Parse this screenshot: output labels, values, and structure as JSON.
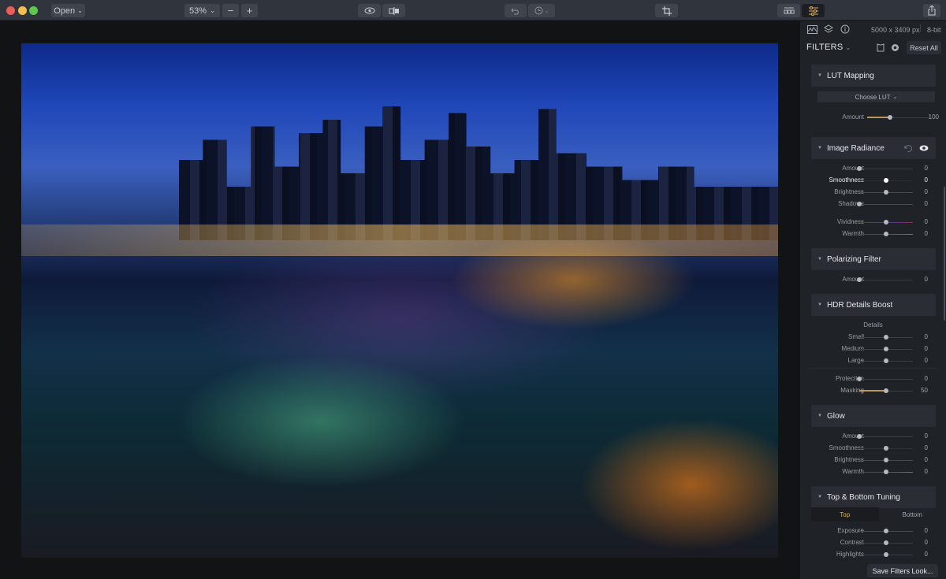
{
  "toolbar": {
    "open_label": "Open",
    "zoom_value": "53%",
    "zoom_out": "−",
    "zoom_in": "+",
    "traffic_colors": {
      "close": "#ed5f56",
      "minimize": "#f6be4f",
      "maximize": "#5dc84f"
    },
    "icons": {
      "eye": "eye-icon",
      "compare": "compare-icon",
      "undo": "undo-icon",
      "history": "history-icon",
      "crop": "crop-icon",
      "presets": "presets-icon",
      "filters": "sliders-icon",
      "share": "share-icon"
    },
    "accent": "#e0b054"
  },
  "sidebar": {
    "image_info": "5000 x 3409 px",
    "bit_depth": "8-bit",
    "filters_title": "FILTERS",
    "reset_all": "Reset All",
    "lut": {
      "title": "LUT Mapping",
      "choose": "Choose LUT",
      "amount_label": "Amount",
      "amount_value": "100",
      "amount_fraction": 0.55
    },
    "radiance": {
      "title": "Image Radiance",
      "rows": [
        {
          "label": "Amount",
          "value": "0"
        },
        {
          "label": "Smoothness",
          "value": "0"
        },
        {
          "label": "Brightness",
          "value": "0"
        },
        {
          "label": "Shadows",
          "value": "0"
        },
        {
          "label": "Vividness",
          "value": "0"
        },
        {
          "label": "Warmth",
          "value": "0"
        }
      ]
    },
    "polarizing": {
      "title": "Polarizing Filter",
      "rows": [
        {
          "label": "Amount",
          "value": "0"
        }
      ]
    },
    "hdr": {
      "title": "HDR Details Boost",
      "details_label": "Details",
      "rows": [
        {
          "label": "Small",
          "value": "0"
        },
        {
          "label": "Medium",
          "value": "0"
        },
        {
          "label": "Large",
          "value": "0"
        },
        {
          "label": "Protection",
          "value": "0"
        },
        {
          "label": "Masking",
          "value": "50"
        }
      ]
    },
    "glow": {
      "title": "Glow",
      "rows": [
        {
          "label": "Amount",
          "value": "0"
        },
        {
          "label": "Smoothness",
          "value": "0"
        },
        {
          "label": "Brightness",
          "value": "0"
        },
        {
          "label": "Warmth",
          "value": "0"
        }
      ]
    },
    "tuning": {
      "title": "Top & Bottom Tuning",
      "tabs": [
        "Top",
        "Bottom"
      ],
      "active_tab": "Top",
      "rows": [
        {
          "label": "Exposure",
          "value": "0"
        },
        {
          "label": "Contrast",
          "value": "0"
        },
        {
          "label": "Highlights",
          "value": "0"
        }
      ]
    },
    "save_look": "Save Filters Look..."
  }
}
